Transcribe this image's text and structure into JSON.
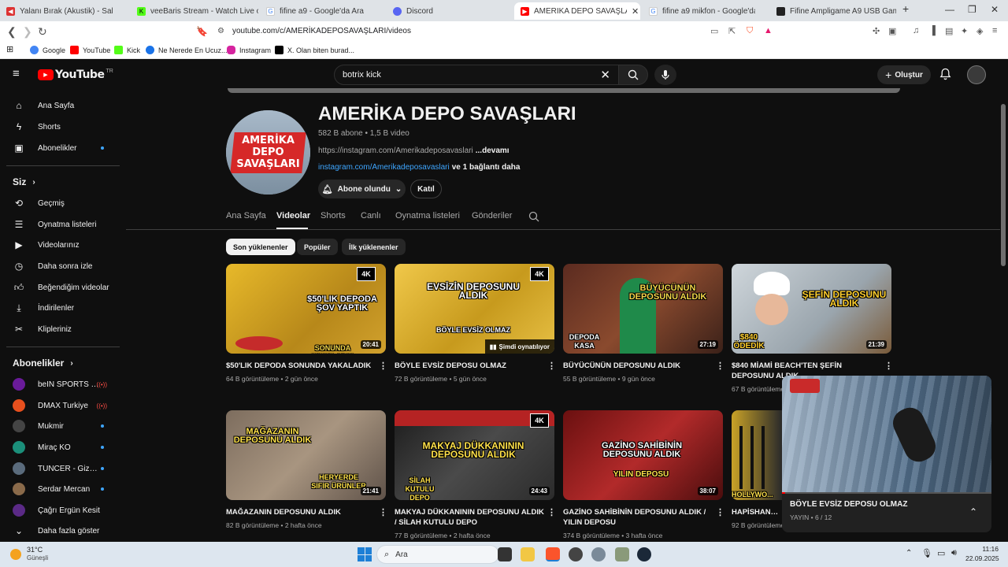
{
  "browser": {
    "tabs": [
      {
        "title": "Yalanı Bırak (Akustik) - Sakiler & ..."
      },
      {
        "title": "veeBaris Stream - Watch Live on Kick"
      },
      {
        "title": "fifine a9 - Google'da Ara"
      },
      {
        "title": "Discord"
      },
      {
        "title": "AMERİKA DEPO SAVAŞLARI - Yo..."
      },
      {
        "title": "fifine a9 mikfon - Google'da Ara"
      },
      {
        "title": "Fifine Ampligame A9 USB Gaming Y..."
      }
    ],
    "url": "youtube.com/c/AMERİKADEPOSAVAŞLARI/videos",
    "bookmarks": [
      "Google",
      "YouTube",
      "Kick",
      "Ne Nerede En Ucuz...",
      "Instagram",
      "X. Olan biten burad..."
    ]
  },
  "yt": {
    "logo": "YouTube",
    "region": "TR",
    "search_value": "botrix kick",
    "create_label": "Oluştur"
  },
  "sidebar": {
    "main": [
      {
        "label": "Ana Sayfa",
        "icon": "home-icon"
      },
      {
        "label": "Shorts",
        "icon": "shorts-icon"
      },
      {
        "label": "Abonelikler",
        "icon": "subscriptions-icon"
      }
    ],
    "you_heading": "Siz",
    "you": [
      {
        "label": "Geçmiş"
      },
      {
        "label": "Oynatma listeleri"
      },
      {
        "label": "Videolarınız"
      },
      {
        "label": "Daha sonra izle"
      },
      {
        "label": "Beğendiğim videolar"
      },
      {
        "label": "İndirilenler"
      },
      {
        "label": "Klipleriniz"
      }
    ],
    "subs_heading": "Abonelikler",
    "subs": [
      {
        "label": "beIN SPORTS Tü...",
        "color": "#6a1b9a",
        "live": true
      },
      {
        "label": "DMAX Turkiye",
        "color": "#e8501e",
        "live": true
      },
      {
        "label": "Mukmir",
        "color": "#444444",
        "live": false
      },
      {
        "label": "Miraç KO",
        "color": "#1b8f7a",
        "live": false
      },
      {
        "label": "TUNCER - Gizem...",
        "color": "#5a6b7c",
        "live": false
      },
      {
        "label": "Serdar Mercan",
        "color": "#8a6a4a",
        "live": false
      },
      {
        "label": "Çağrı Ergün Kesit",
        "color": "#5b2a86",
        "live": false
      }
    ],
    "more_label": "Daha fazla göster"
  },
  "channel": {
    "avatar_text": "AMERİKA DEPO SAVAŞLARI",
    "name": "AMERİKA DEPO SAVAŞLARI",
    "stats": "582 B abone • 1,5 B video",
    "description": "https://instagram.com/Amerikadeposavaslari",
    "more": "...devamı",
    "link": "instagram.com/Amerikadeposavaslari",
    "link_more": "ve 1 bağlantı daha",
    "subscribed_label": "Abone olundu",
    "join_label": "Katıl",
    "tabs": [
      "Ana Sayfa",
      "Videolar",
      "Shorts",
      "Canlı",
      "Oynatma listeleri",
      "Gönderiler"
    ],
    "chips": [
      "Son yüklenenler",
      "Popüler",
      "İlk yüklenenler"
    ]
  },
  "videos": [
    {
      "title": "$50'LIK DEPODA SONUNDA YAKALADIK",
      "views": "64 B görüntüleme",
      "age": "2 gün önce",
      "duration": "20:41",
      "thumb_text": "$50'LIK DEPODA ŞOV YAPTIK",
      "thumb_sub": "SONUNDA YAKALADIK",
      "bg": "#d9a41d"
    },
    {
      "title": "BÖYLE EVSİZ DEPOSU OLMAZ",
      "views": "72 B görüntüleme",
      "age": "5 gün önce",
      "duration": "",
      "thumb_text": "EVSİZİN DEPOSUNU ALDIK",
      "thumb_sub": "BÖYLE EVSİZ OLMAZ",
      "bg": "#e1b431",
      "now_playing": "Şimdi oynatılıyor"
    },
    {
      "title": "BÜYÜCÜNÜN DEPOSUNU ALDIK",
      "views": "55 B görüntüleme",
      "age": "9 gün önce",
      "duration": "27:19",
      "thumb_text": "BÜYÜCÜNÜN DEPOSUNU ALDIK",
      "thumb_sub": "DEPODA KASA",
      "bg": "#6f3b2c"
    },
    {
      "title": "$840 MİAMİ BEACH'TEN ŞEFİN DEPOSUNU ALDIK",
      "views": "67 B görüntüleme",
      "age": "",
      "duration": "21:39",
      "thumb_text": "ŞEFİN DEPOSUNU ALDIK",
      "thumb_sub": "$840 ÖDEDİK",
      "bg": "#b7c0c6"
    },
    {
      "title": "MAĞAZANIN DEPOSUNU ALDIK",
      "views": "82 B görüntüleme",
      "age": "2 hafta önce",
      "duration": "21:41",
      "thumb_text": "MAĞAZANIN DEPOSUNU ALDIK",
      "thumb_sub": "HERYERDE SIFIR ÜRÜNLER",
      "bg": "#8a7c6d"
    },
    {
      "title": "MAKYAJ DÜKKANININ DEPOSUNU ALDIK / SİLAH KUTULU DEPO",
      "views": "77 B görüntüleme",
      "age": "2 hafta önce",
      "duration": "24:43",
      "thumb_text": "MAKYAJ DÜKKANININ DEPOSUNU ALDIK",
      "thumb_sub": "SİLAH KUTULU DEPO",
      "bg": "#3b3b3b"
    },
    {
      "title": "GAZİNO SAHİBİNİN DEPOSUNU ALDIK / YILIN DEPOSU",
      "views": "374 B görüntüleme",
      "age": "3 hafta önce",
      "duration": "38:07",
      "thumb_text": "GAZİNO SAHİBİNİN DEPOSUNU ALDIK",
      "thumb_sub": "YILIN DEPOSU",
      "bg": "#8c1d1d"
    },
    {
      "title": "HAPİSHANEDE...",
      "views": "92 B görüntüleme",
      "age": "",
      "duration": "",
      "thumb_text": "",
      "thumb_sub": "HOLLYWO...",
      "bg": "#c9a227"
    }
  ],
  "miniplayer": {
    "title": "BÖYLE EVSİZ DEPOSU OLMAZ",
    "meta": "YAYIN • 6 / 12"
  },
  "taskbar": {
    "weather_temp": "31°C",
    "weather_desc": "Güneşli",
    "search_label": "Ara",
    "time": "11:16",
    "date": "22.09.2025"
  }
}
